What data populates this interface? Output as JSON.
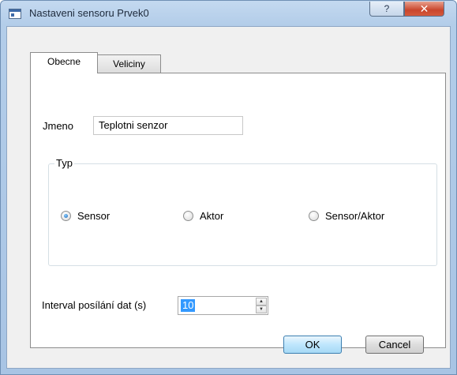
{
  "window": {
    "title": "Nastaveni sensoru Prvek0",
    "help_glyph": "?",
    "close_glyph": "✕"
  },
  "tabs": [
    {
      "label": "Obecne",
      "active": true
    },
    {
      "label": "Veliciny",
      "active": false
    }
  ],
  "form": {
    "name_label": "Jmeno",
    "name_value": "Teplotni senzor",
    "type_group": {
      "title": "Typ",
      "options": [
        {
          "label": "Sensor",
          "checked": true
        },
        {
          "label": "Aktor",
          "checked": false
        },
        {
          "label": "Sensor/Aktor",
          "checked": false
        }
      ]
    },
    "interval_label": "Interval posílání dat (s)",
    "interval_value": "10"
  },
  "buttons": {
    "ok": "OK",
    "cancel": "Cancel"
  },
  "colors": {
    "title_bar": "#b3cde9",
    "close_button": "#c9462c",
    "selection": "#3399ff"
  },
  "icons": [
    "app-window-icon",
    "help-icon",
    "close-icon",
    "spin-up-icon",
    "spin-down-icon"
  ]
}
